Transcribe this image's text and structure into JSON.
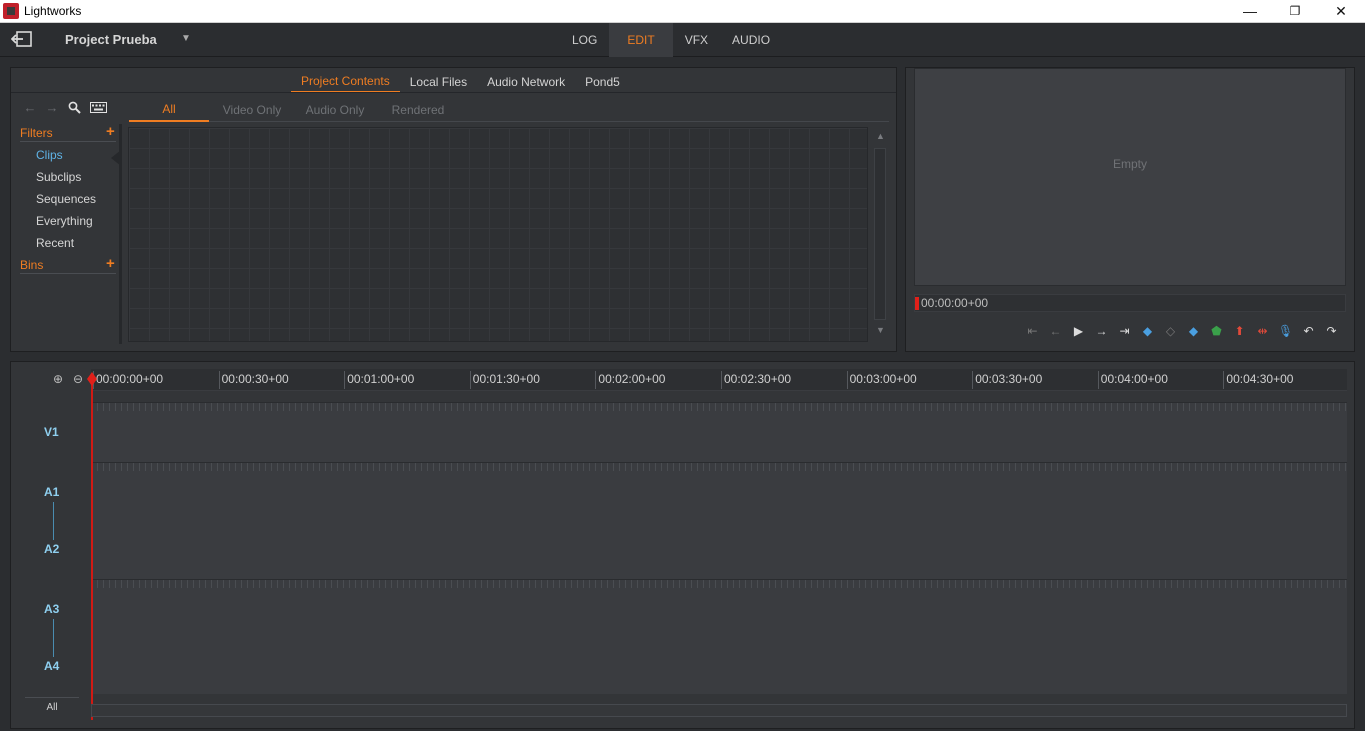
{
  "window": {
    "title": "Lightworks",
    "minimize": "—",
    "restore": "❐",
    "close": "✕"
  },
  "topbar": {
    "project_name": "Project Prueba",
    "caret": "▼",
    "tabs": [
      {
        "label": "LOG",
        "active": false
      },
      {
        "label": "EDIT",
        "active": true
      },
      {
        "label": "VFX",
        "active": false
      },
      {
        "label": "AUDIO",
        "active": false
      }
    ]
  },
  "content_manager": {
    "source_tabs": [
      {
        "label": "Project Contents",
        "active": true
      },
      {
        "label": "Local Files",
        "active": false
      },
      {
        "label": "Audio Network",
        "active": false
      },
      {
        "label": "Pond5",
        "active": false
      }
    ],
    "filter_tabs": [
      {
        "label": "All",
        "active": true
      },
      {
        "label": "Video Only",
        "active": false
      },
      {
        "label": "Audio Only",
        "active": false
      },
      {
        "label": "Rendered",
        "active": false
      }
    ],
    "sidebar": {
      "filters_header": "Filters",
      "plus": "+",
      "items": [
        {
          "label": "Clips",
          "active": true
        },
        {
          "label": "Subclips",
          "active": false
        },
        {
          "label": "Sequences",
          "active": false
        },
        {
          "label": "Everything",
          "active": false
        },
        {
          "label": "Recent",
          "active": false
        }
      ],
      "bins_header": "Bins"
    }
  },
  "viewer": {
    "empty_label": "Empty",
    "timecode": "00:00:00+00"
  },
  "timeline": {
    "ruler_labels": [
      "00:00:00+00",
      "00:00:30+00",
      "00:01:00+00",
      "00:01:30+00",
      "00:02:00+00",
      "00:02:30+00",
      "00:03:00+00",
      "00:03:30+00",
      "00:04:00+00",
      "00:04:30+00"
    ],
    "tracks": [
      "V1",
      "A1",
      "A2",
      "A3",
      "A4"
    ],
    "all_label": "All"
  },
  "colors": {
    "accent": "#ef7d22",
    "active_item": "#5fb3e6",
    "track_label": "#8fd0f0",
    "playhead": "#e0201a"
  }
}
